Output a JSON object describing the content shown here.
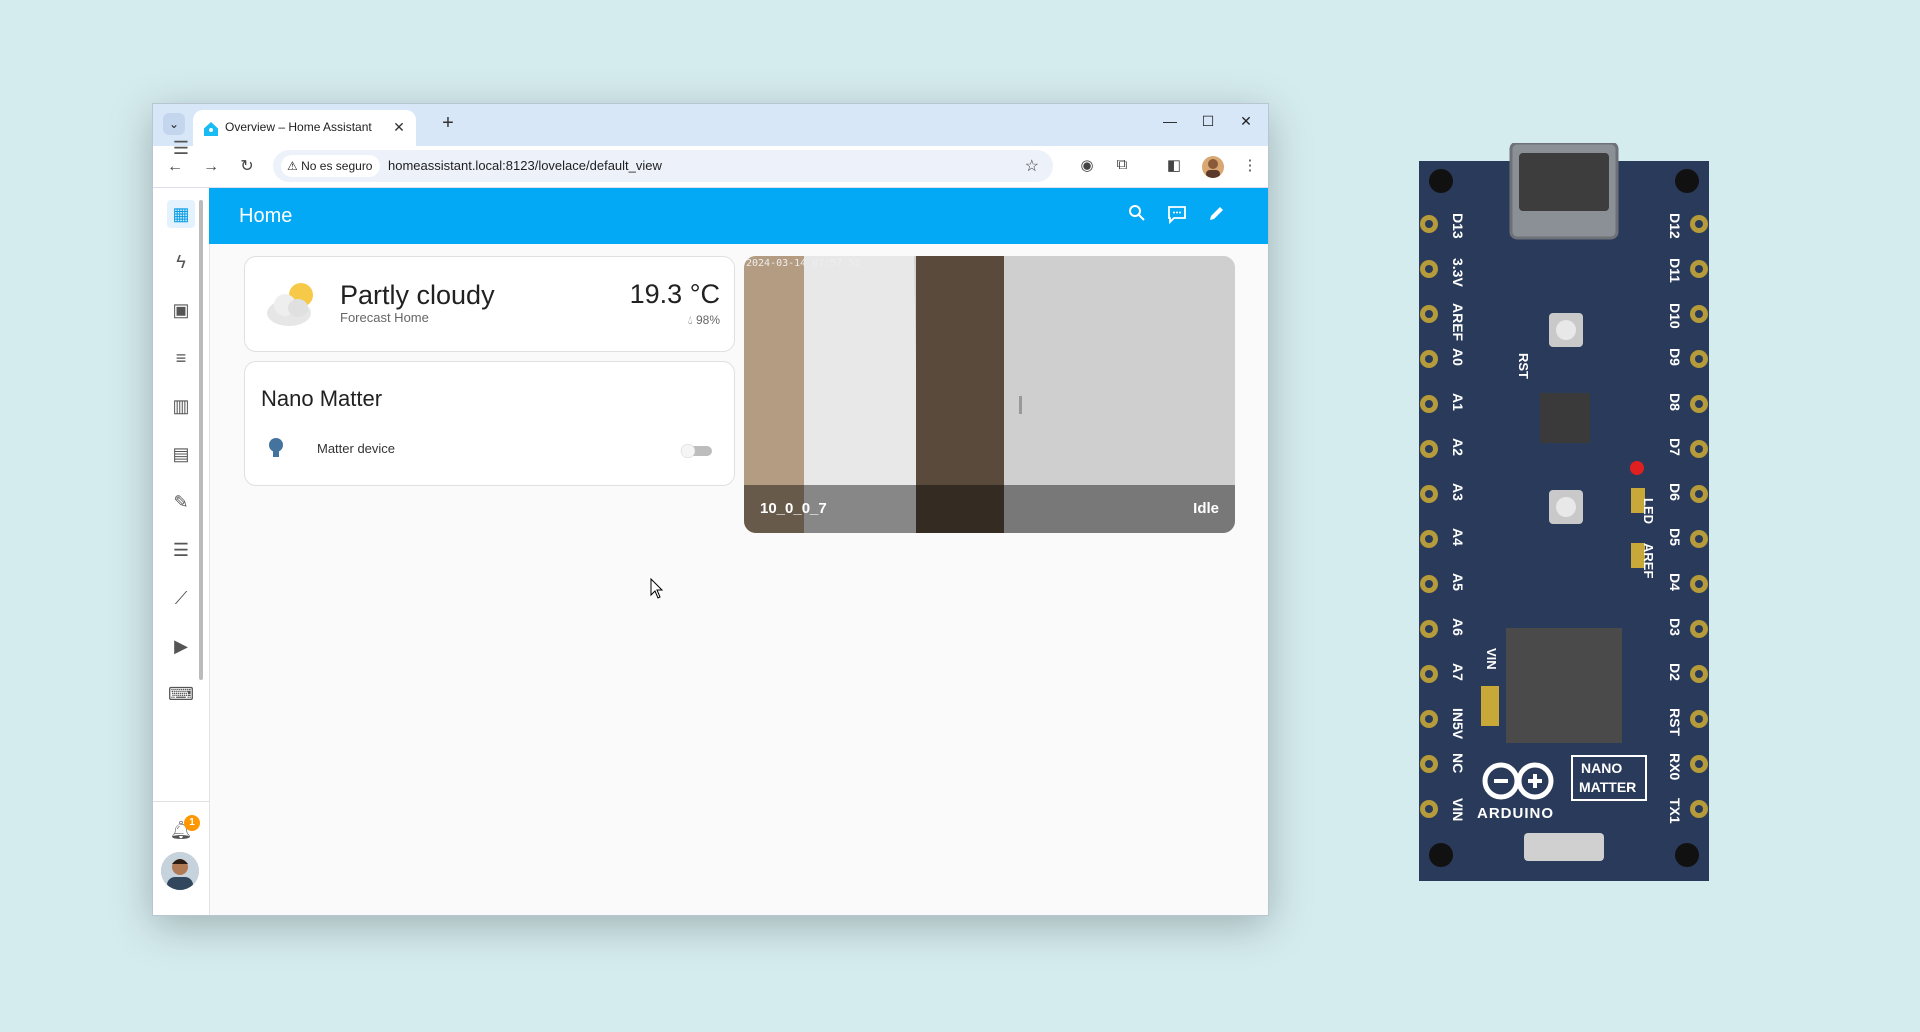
{
  "browser": {
    "tab_title": "Overview – Home Assistant",
    "security_label": "No es seguro",
    "url": "homeassistant.local:8123/lovelace/default_view"
  },
  "header": {
    "title": "Home"
  },
  "sidebar": {
    "items": [
      {
        "icon": "dashboard-icon"
      },
      {
        "icon": "energy-icon"
      },
      {
        "icon": "map-icon"
      },
      {
        "icon": "todo-list-icon"
      },
      {
        "icon": "history-icon"
      },
      {
        "icon": "hacs-icon"
      },
      {
        "icon": "wrench-icon"
      },
      {
        "icon": "logbook-icon"
      },
      {
        "icon": "statistics-icon"
      },
      {
        "icon": "media-icon"
      },
      {
        "icon": "terminal-icon"
      }
    ],
    "notifications_count": "1"
  },
  "weather": {
    "condition": "Partly cloudy",
    "source": "Forecast Home",
    "temperature": "19.3 °C",
    "humidity": "98%"
  },
  "matter_card": {
    "title": "Nano Matter",
    "entity_name": "Matter device",
    "toggle_on": false
  },
  "camera": {
    "name": "10_0_0_7",
    "state": "Idle",
    "timestamp": "2024-03-14 07:57:52"
  },
  "board": {
    "pins_left": [
      "D13",
      "3.3V",
      "AREF",
      "A0",
      "A1",
      "A2",
      "A3",
      "A4",
      "A5",
      "A6",
      "A7",
      "IN5V",
      "NC",
      "VIN"
    ],
    "pins_right": [
      "D12",
      "D11",
      "D10",
      "D9",
      "D8",
      "D7",
      "D6",
      "D5",
      "D4",
      "D3",
      "D2",
      "RST",
      "RX0",
      "TX1"
    ],
    "center_labels": [
      "RST",
      "LED",
      "AREF",
      "VIN"
    ],
    "brand": "ARDUINO",
    "product": [
      "NANO",
      "MATTER"
    ]
  },
  "colors": {
    "ha_primary": "#03a9f4",
    "page_bg": "#d5ecef",
    "badge": "#ff9800"
  }
}
